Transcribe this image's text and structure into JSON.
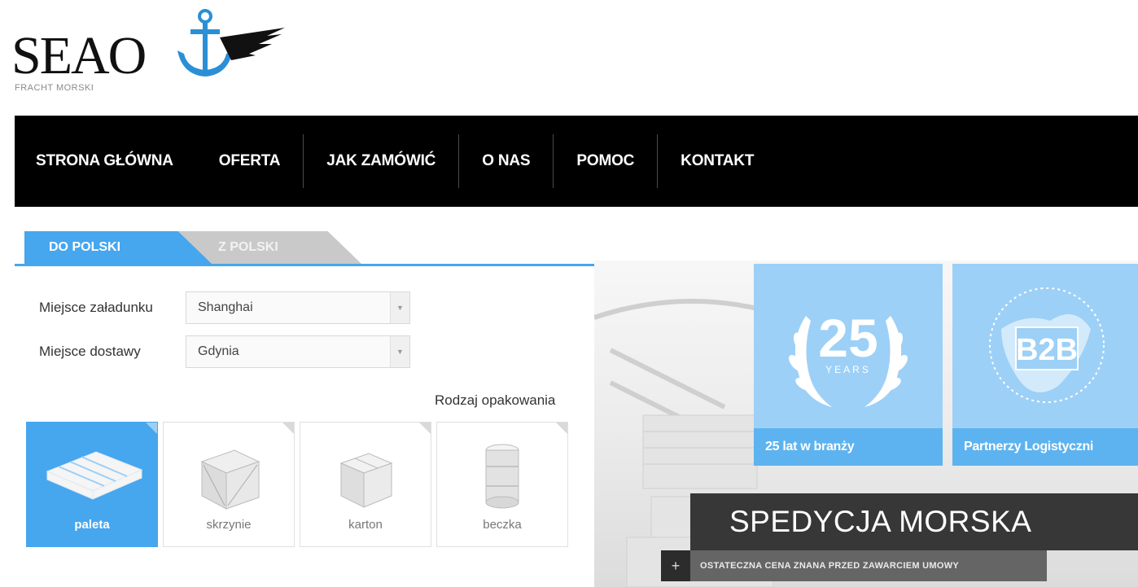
{
  "logo": {
    "text": "SEAO",
    "subtitle": "FRACHT MORSKI"
  },
  "nav": {
    "items": [
      {
        "label": "STRONA GŁÓWNA"
      },
      {
        "label": "OFERTA"
      },
      {
        "label": "JAK ZAMÓWIĆ"
      },
      {
        "label": "O NAS"
      },
      {
        "label": "POMOC"
      },
      {
        "label": "KONTAKT"
      }
    ]
  },
  "tabs": {
    "active": "DO POLSKI",
    "inactive": "Z POLSKI"
  },
  "form": {
    "loading_label": "Miejsce załadunku",
    "loading_value": "Shanghai",
    "delivery_label": "Miejsce dostawy",
    "delivery_value": "Gdynia",
    "packaging_title": "Rodzaj opakowania"
  },
  "packaging": [
    {
      "label": "paleta",
      "selected": true
    },
    {
      "label": "skrzynie",
      "selected": false
    },
    {
      "label": "karton",
      "selected": false
    },
    {
      "label": "beczka",
      "selected": false
    }
  ],
  "tiles": [
    {
      "number": "25",
      "badge": "YEARS",
      "caption": "25 lat w branży"
    },
    {
      "badge": "B2B",
      "caption": "Partnerzy Logistyczni"
    }
  ],
  "banner": {
    "title": "SPEDYCJA MORSKA",
    "subtitle": "OSTATECZNA CENA ZNANA PRZED ZAWARCIEM UMOWY",
    "plus": "+"
  },
  "colors": {
    "accent": "#46a6ee",
    "tile": "#9dd0f6",
    "nav": "#000000"
  }
}
